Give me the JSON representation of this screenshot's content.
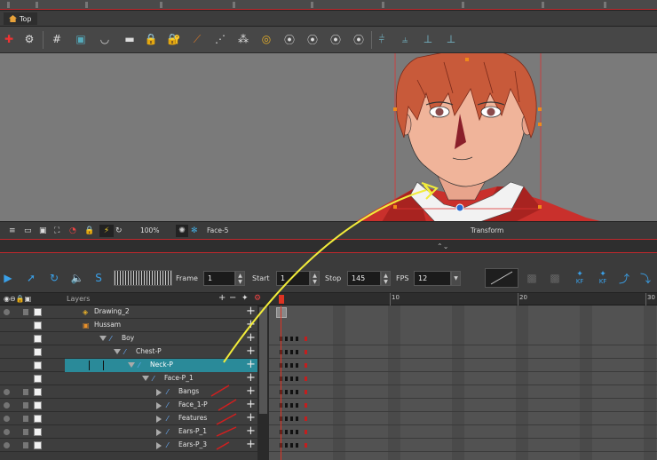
{
  "view_tab": {
    "label": "Top"
  },
  "camera": {
    "zoom": "100%",
    "current_drawing": "Face-5",
    "mode": "Transform"
  },
  "playback": {
    "frame_label": "Frame",
    "frame_value": "1",
    "start_label": "Start",
    "start_value": "1",
    "stop_label": "Stop",
    "stop_value": "145",
    "fps_label": "FPS",
    "fps_value": "12",
    "kf_label_1": "KF",
    "kf_label_2": "KF"
  },
  "layer_panel": {
    "header": "Layers",
    "layers": [
      {
        "name": "Drawing_2",
        "level": 0,
        "type": "drawing"
      },
      {
        "name": "Hussam",
        "level": 0,
        "type": "group"
      },
      {
        "name": "Boy",
        "level": 1,
        "type": "peg",
        "expanded": true
      },
      {
        "name": "Chest-P",
        "level": 2,
        "type": "peg",
        "expanded": true
      },
      {
        "name": "Neck-P",
        "level": 3,
        "type": "peg",
        "expanded": true,
        "selected": true
      },
      {
        "name": "Face-P_1",
        "level": 4,
        "type": "peg",
        "expanded": true
      },
      {
        "name": "Bangs",
        "level": 5,
        "type": "peg",
        "expanded": false,
        "marked": true
      },
      {
        "name": "Face_1-P",
        "level": 5,
        "type": "peg",
        "expanded": false,
        "marked": true
      },
      {
        "name": "Features",
        "level": 5,
        "type": "peg",
        "expanded": false,
        "marked": true
      },
      {
        "name": "Ears-P_1",
        "level": 5,
        "type": "peg",
        "expanded": false,
        "marked": true
      },
      {
        "name": "Ears-P_3",
        "level": 5,
        "type": "peg",
        "expanded": false,
        "marked": true
      }
    ]
  },
  "timeline": {
    "ruler_labels": [
      "10",
      "20",
      "30"
    ]
  },
  "colors": {
    "selection": "#2a8a99",
    "annotation_arrow": "#f2ec3a",
    "annotation_marks": "#d11f1f",
    "hair": "#c85a3a",
    "jacket": "#c9302c"
  }
}
